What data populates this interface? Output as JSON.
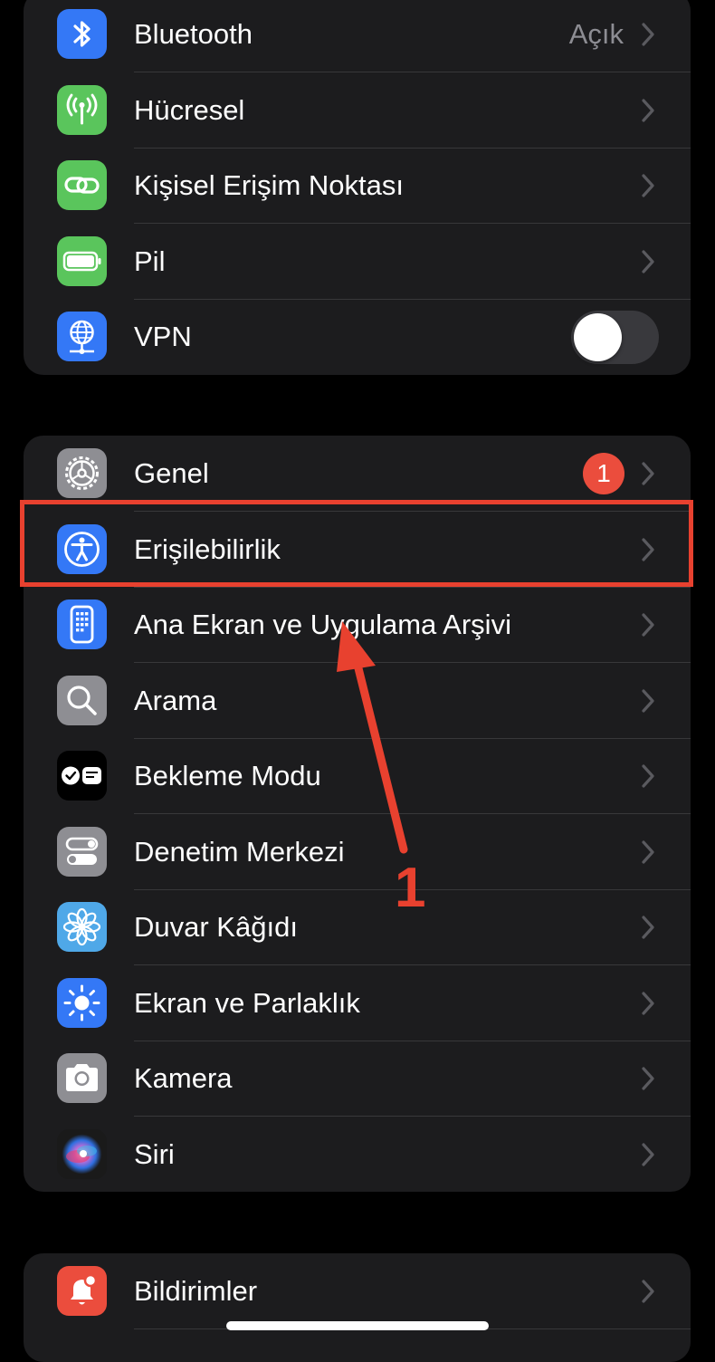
{
  "group1": {
    "bluetooth": {
      "label": "Bluetooth",
      "value": "Açık",
      "icon": "bluetooth-icon",
      "color": "#3478f6"
    },
    "cellular": {
      "label": "Hücresel",
      "icon": "cellular-antenna-icon",
      "color": "#5ac55c"
    },
    "hotspot": {
      "label": "Kişisel Erişim Noktası",
      "icon": "link-icon",
      "color": "#5ac55c"
    },
    "battery": {
      "label": "Pil",
      "icon": "battery-icon",
      "color": "#5ac55c"
    },
    "vpn": {
      "label": "VPN",
      "icon": "globe-network-icon",
      "color": "#3478f6",
      "toggle_on": false
    }
  },
  "group2": {
    "general": {
      "label": "Genel",
      "badge": "1",
      "icon": "gear-icon",
      "color": "#8e8e93"
    },
    "accessibility": {
      "label": "Erişilebilirlik",
      "icon": "accessibility-icon",
      "color": "#3478f6"
    },
    "home_screen": {
      "label": "Ana Ekran ve Uygulama Arşivi",
      "icon": "phone-grid-icon",
      "color": "#3478f6"
    },
    "search": {
      "label": "Arama",
      "icon": "magnifier-icon",
      "color": "#8e8e93"
    },
    "standby": {
      "label": "Bekleme Modu",
      "icon": "standby-icon",
      "color": "#000000"
    },
    "control_center": {
      "label": "Denetim Merkezi",
      "icon": "toggles-icon",
      "color": "#8e8e93"
    },
    "wallpaper": {
      "label": "Duvar Kâğıdı",
      "icon": "flower-icon",
      "color": "#4fa8e8"
    },
    "display": {
      "label": "Ekran ve Parlaklık",
      "icon": "sun-icon",
      "color": "#3478f6"
    },
    "camera": {
      "label": "Kamera",
      "icon": "camera-icon",
      "color": "#8e8e93"
    },
    "siri": {
      "label": "Siri",
      "icon": "siri-icon",
      "color": "#1a1a1a"
    }
  },
  "group3": {
    "notifications": {
      "label": "Bildirimler",
      "icon": "bell-badge-icon",
      "color": "#eb4d3d"
    }
  },
  "annotation": {
    "step_number": "1",
    "color": "#e8412f"
  }
}
